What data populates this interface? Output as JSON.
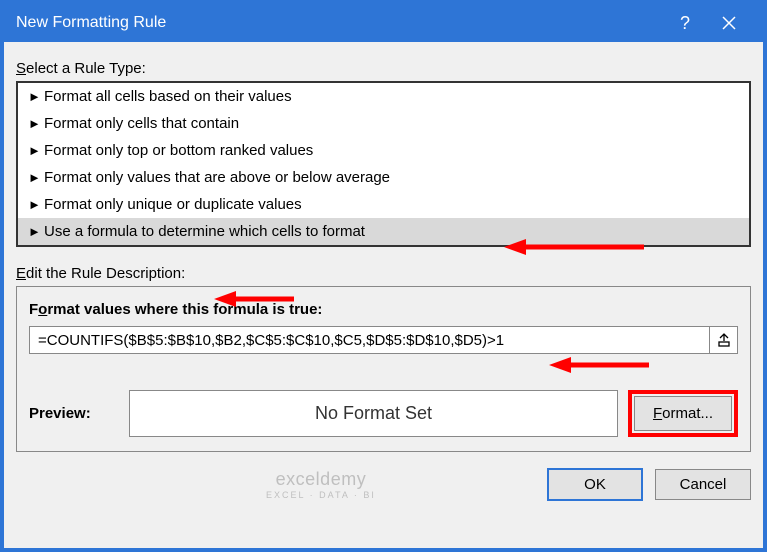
{
  "titlebar": {
    "title": "New Formatting Rule"
  },
  "section": {
    "select_label_pre": "S",
    "select_label_post": "elect a Rule Type:",
    "edit_label_pre": "E",
    "edit_label_post": "dit the Rule Description:"
  },
  "rule_types": [
    "Format all cells based on their values",
    "Format only cells that contain",
    "Format only top or bottom ranked values",
    "Format only values that are above or below average",
    "Format only unique or duplicate values",
    "Use a formula to determine which cells to format"
  ],
  "formula": {
    "label_pre": "F",
    "label_mid": "o",
    "label_post": "rmat values where this formula is true:",
    "value": "=COUNTIFS($B$5:$B$10,$B2,$C$5:$C$10,$C5,$D$5:$D$10,$D5)>1"
  },
  "preview": {
    "label": "Preview:",
    "text": "No Format Set",
    "format_btn_pre": "F",
    "format_btn_post": "ormat..."
  },
  "footer": {
    "ok": "OK",
    "cancel": "Cancel"
  },
  "watermark": {
    "main": "exceldemy",
    "sub": "EXCEL · DATA · BI"
  }
}
